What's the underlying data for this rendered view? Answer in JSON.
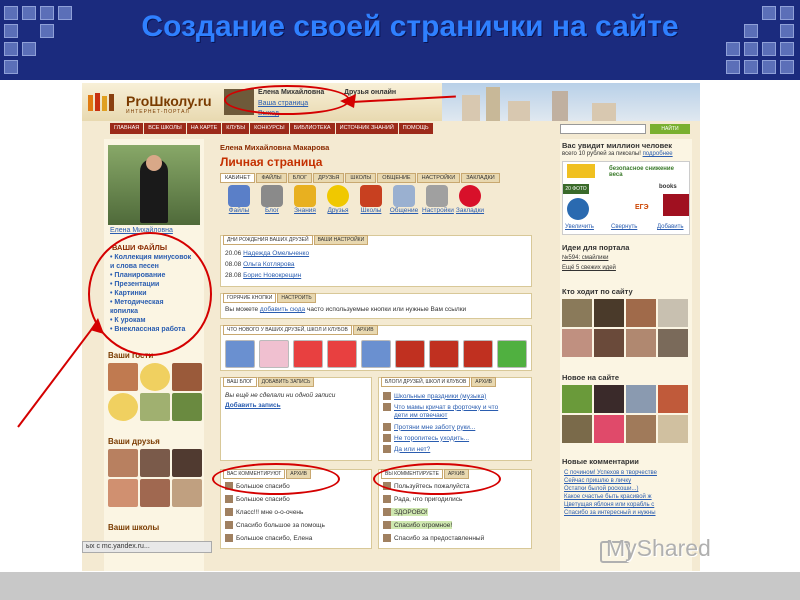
{
  "slide": {
    "title": "Создание своей странички на сайте"
  },
  "site": {
    "logo": {
      "name": "ProШколу.ru",
      "sub": "ИНТЕРНЕТ-ПОРТАЛ"
    },
    "user": {
      "name": "Елена Михайловна",
      "friends_online": "Друзья онлайн",
      "links": [
        "Ваша страница",
        "Выход"
      ]
    },
    "nav": [
      "ГЛАВНАЯ",
      "ВСЕ ШКОЛЫ",
      "НА КАРТЕ",
      "КЛУБЫ",
      "КОНКУРСЫ",
      "БИБЛИОТЕКА",
      "ИСТОЧНИК ЗНАНИЙ",
      "ПОМОЩЬ"
    ],
    "search_button": "НАЙТИ"
  },
  "left": {
    "photo_caption": "Елена Михайловна",
    "files_title": "ВАШИ ФАЙЛЫ",
    "files": [
      "• Коллекция минусовок",
      "  и слова песен",
      "• Планирование",
      "• Презентации",
      "• Картинки",
      "• Методическая",
      "  копилка",
      "• К урокам",
      "• Внеклассная работа"
    ],
    "guests_title": "Ваши гости",
    "friends_title": "Ваши друзья",
    "schools_title": "Ваши школы"
  },
  "main": {
    "owner": "Елена Михайловна Макарова",
    "heading": "Личная страница",
    "tabs": [
      "КАБИНЕТ",
      "ФАЙЛЫ",
      "БЛОГ",
      "ДРУЗЬЯ",
      "ШКОЛЫ",
      "ОБЩЕНИЕ",
      "НАСТРОЙКИ",
      "ЗАКЛАДКИ"
    ],
    "icons": [
      {
        "label": "Файлы",
        "icon": "files-icon",
        "color": "#5a7fc8"
      },
      {
        "label": "Блог",
        "icon": "blog-icon",
        "color": "#8a8a8a"
      },
      {
        "label": "Знания",
        "icon": "knowledge-icon",
        "color": "#e8b020"
      },
      {
        "label": "Друзья",
        "icon": "smiley-icon",
        "color": "#f0c800"
      },
      {
        "label": "Школы",
        "icon": "school-icon",
        "color": "#c84020"
      },
      {
        "label": "Общение",
        "icon": "chat-icon",
        "color": "#9ab0d0"
      },
      {
        "label": "Настройки",
        "icon": "wrench-icon",
        "color": "#a0a0a0"
      },
      {
        "label": "Закладки",
        "icon": "heart-icon",
        "color": "#d8102a"
      }
    ],
    "birthdays": {
      "tabs": [
        "ДНИ РОЖДЕНИЯ ВАШИХ ДРУЗЕЙ",
        "ВАШИ НАСТРОЙКИ"
      ],
      "items": [
        {
          "date": "20.06",
          "name": "Надежда Омельченко"
        },
        {
          "date": "08.08",
          "name": "Ольга Котлярова"
        },
        {
          "date": "28.08",
          "name": "Борис Новокрещин"
        }
      ]
    },
    "hotkeys": {
      "tabs": [
        "ГОРЯЧИЕ КНОПКИ",
        "НАСТРОИТЬ"
      ],
      "text_before": "Вы можете ",
      "link": "добавить сюда",
      "text_after": " часто используемые кнопки или нужные Вам ссылки"
    },
    "news": {
      "tabs": [
        "ЧТО НОВОГО У ВАШИХ ДРУЗЕЙ, ШКОЛ И КЛУБОВ",
        "АРХИВ"
      ]
    },
    "blog": {
      "tabs": [
        "ВАШ БЛОГ",
        "ДОБАВИТЬ ЗАПИСЬ"
      ],
      "empty": "Вы ещё не сделали ни одной записи",
      "add": "Добавить запись"
    },
    "friends_blogs": {
      "tabs": [
        "БЛОГИ ДРУЗЕЙ, ШКОЛ И КЛУБОВ",
        "АРХИВ"
      ],
      "items": [
        "Школьные праздники (музыка)",
        "Что мамы кричат в форточку и что",
        "дети им отвечают",
        "Протяни мне заботу руки...",
        "Не торопитесь уходить...",
        "Да или нет?"
      ]
    },
    "commented_you": {
      "tabs": [
        "ВАС КОММЕНТИРУЮТ",
        "АРХИВ"
      ],
      "items": [
        "Большое спасибо",
        "Большое спасибо",
        "Класс!!! мне о-о-очень",
        "Спасибо большое за помощь",
        "Большое спасибо, Елена"
      ]
    },
    "you_commented": {
      "tabs": [
        "ВЫ КОММЕНТИРУЕТЕ",
        "АРХИВ"
      ],
      "items": [
        "Пользуйтесь пожалуйста",
        "Рада, что пригодились",
        "ЗДОРОВО!",
        "Спасибо огромное!",
        "Спасибо за предоставленный"
      ]
    }
  },
  "right": {
    "ad_title": "Вас увидит миллион человек",
    "ad_sub": "всего 10 рублей за пикселы!",
    "ad_more": "подробнее",
    "weight": "безопасное снижение веса",
    "books": "books",
    "foto": "20 ФОТО",
    "ege": "ЕГЭ",
    "actions": [
      "Увеличить",
      "Свернуть",
      "Добавить"
    ],
    "ideas_title": "Идеи для портала",
    "ideas": [
      "№594: смайлики",
      "Ещё 5 свежих идей"
    ],
    "who_title": "Кто ходит по сайту",
    "new_title": "Новое на сайте",
    "comments_title": "Новые комментарии",
    "comments": [
      "С почином! Успехов в творчестве",
      "Сейчас пришлю в личку",
      "Остатки былой роскоши...)",
      "Какое счастье быть красивой ж",
      "Цветущая яблоня или корабль с",
      "Спасибо за интересный и нужны"
    ]
  },
  "browser": {
    "status": "ых с mc.yandex.ru..."
  },
  "watermark": "MyShared",
  "colors": {
    "accent": "#c43000",
    "link": "#2a5db0",
    "annotation": "#d40000",
    "header": "#1b2b7e"
  }
}
